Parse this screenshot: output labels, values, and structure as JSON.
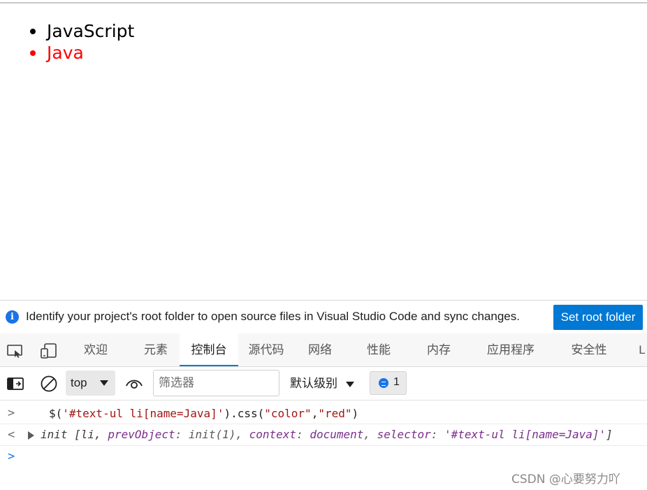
{
  "page": {
    "list_items": [
      {
        "text": "JavaScript",
        "color": "#000000"
      },
      {
        "text": "Java",
        "color": "#ff0000"
      }
    ]
  },
  "infobar": {
    "message": "Identify your project's root folder to open source files in Visual Studio Code and sync changes.",
    "button_label": "Set root folder",
    "icon": "info-icon"
  },
  "devtools": {
    "tabs": [
      "欢迎",
      "元素",
      "控制台",
      "源代码",
      "网络",
      "性能",
      "内存",
      "应用程序",
      "安全性",
      "L"
    ],
    "active_tab": "控制台",
    "toolbar": {
      "context": "top",
      "filter_placeholder": "筛选器",
      "level": "默认级别",
      "message_count": "1"
    },
    "console": {
      "input_line": {
        "prefix": "$(",
        "arg": "'#text-ul li[name=Java]'",
        "mid": ").css(",
        "arg2": "\"color\"",
        "comma": ",",
        "arg3": "\"red\"",
        "suffix": ")"
      },
      "result": {
        "head": "init [li, ",
        "k1": "prevObject",
        "v1": ": init(1), ",
        "k2": "context",
        "v2": ": ",
        "v2b": "document",
        "sep2": ", ",
        "k3": "selector",
        "v3": ": ",
        "s3": "'#text-ul li[name=Java]'",
        "tail": "]"
      }
    }
  },
  "watermark": "CSDN @心要努力吖"
}
